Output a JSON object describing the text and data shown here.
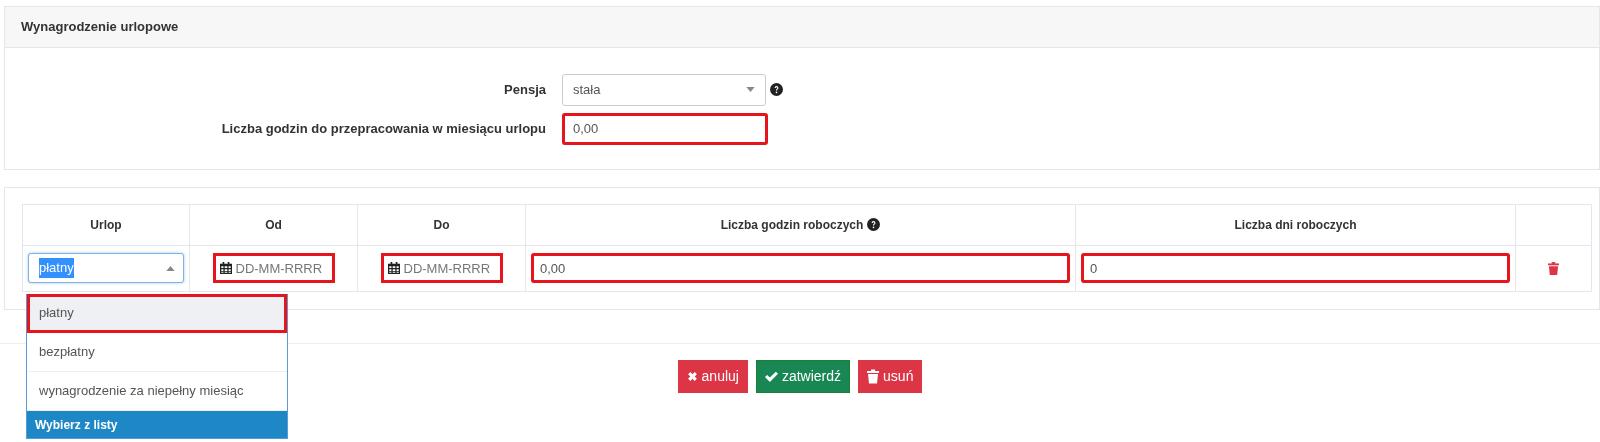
{
  "panel": {
    "title": "Wynagrodzenie urlopowe"
  },
  "form": [
    {
      "kind": "select",
      "label": "Pensja",
      "value": "stała",
      "help": true,
      "highlighted": false
    },
    {
      "kind": "input",
      "label": "Liczba godzin do przepracowania w miesiącu urlopu",
      "value": "0,00",
      "help": false,
      "highlighted": true
    }
  ],
  "table": {
    "columns": [
      {
        "label": "Urlop",
        "help": false
      },
      {
        "label": "Od",
        "help": false
      },
      {
        "label": "Do",
        "help": false
      },
      {
        "label": "Liczba godzin roboczych",
        "help": true
      },
      {
        "label": "Liczba dni roboczych",
        "help": false
      }
    ],
    "rows": [
      {
        "leave_type": {
          "value": "płatny",
          "expanded": true,
          "text_selected": true
        },
        "from": {
          "placeholder": "DD-MM-RRRR",
          "highlighted": true
        },
        "to": {
          "placeholder": "DD-MM-RRRR",
          "highlighted": true
        },
        "hours": {
          "value": "0,00",
          "highlighted": true
        },
        "days": {
          "value": "0",
          "highlighted": true
        }
      }
    ]
  },
  "dropdown": {
    "options": [
      {
        "label": "płatny",
        "selected": true,
        "highlighted": true
      },
      {
        "label": "bezpłatny",
        "selected": false,
        "highlighted": false
      },
      {
        "label": "wynagrodzenie za niepełny miesiąc",
        "selected": false,
        "highlighted": false
      }
    ],
    "footer": "Wybierz z listy"
  },
  "buttons": [
    {
      "kind": "cancel",
      "label": "anuluj"
    },
    {
      "kind": "confirm",
      "label": "zatwierdź"
    },
    {
      "kind": "delete",
      "label": "usuń"
    }
  ]
}
